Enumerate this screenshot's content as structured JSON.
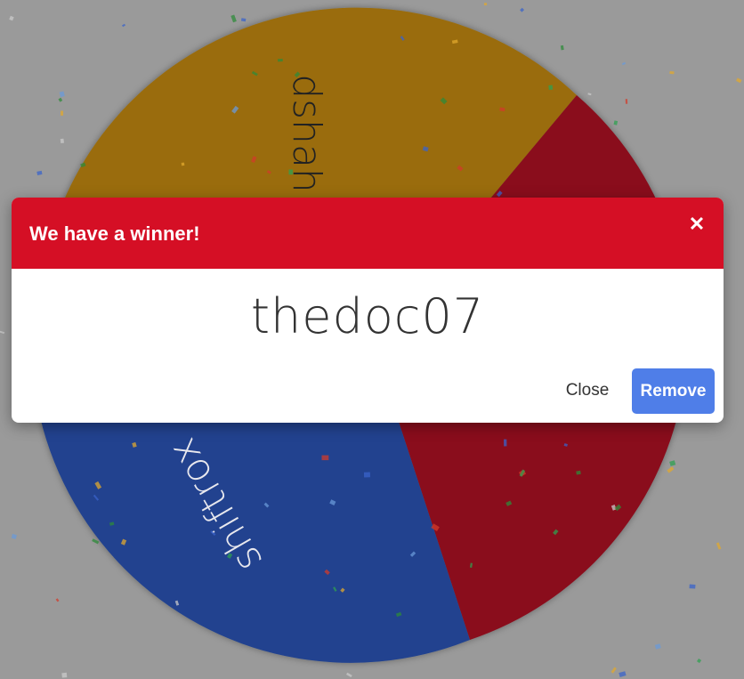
{
  "wheel": {
    "segments": [
      {
        "label": "dshah",
        "color": "#9a6c0a"
      },
      {
        "label": "thedoc07",
        "color": "#8a0b1c"
      },
      {
        "label": "shiftrox",
        "color": "#21438f"
      }
    ]
  },
  "modal": {
    "title": "We have a winner!",
    "close_icon": "close-icon",
    "winner": "thedoc07",
    "close_label": "Close",
    "remove_label": "Remove",
    "colors": {
      "header": "#d50f25",
      "remove_button": "#4f7ee8"
    }
  }
}
